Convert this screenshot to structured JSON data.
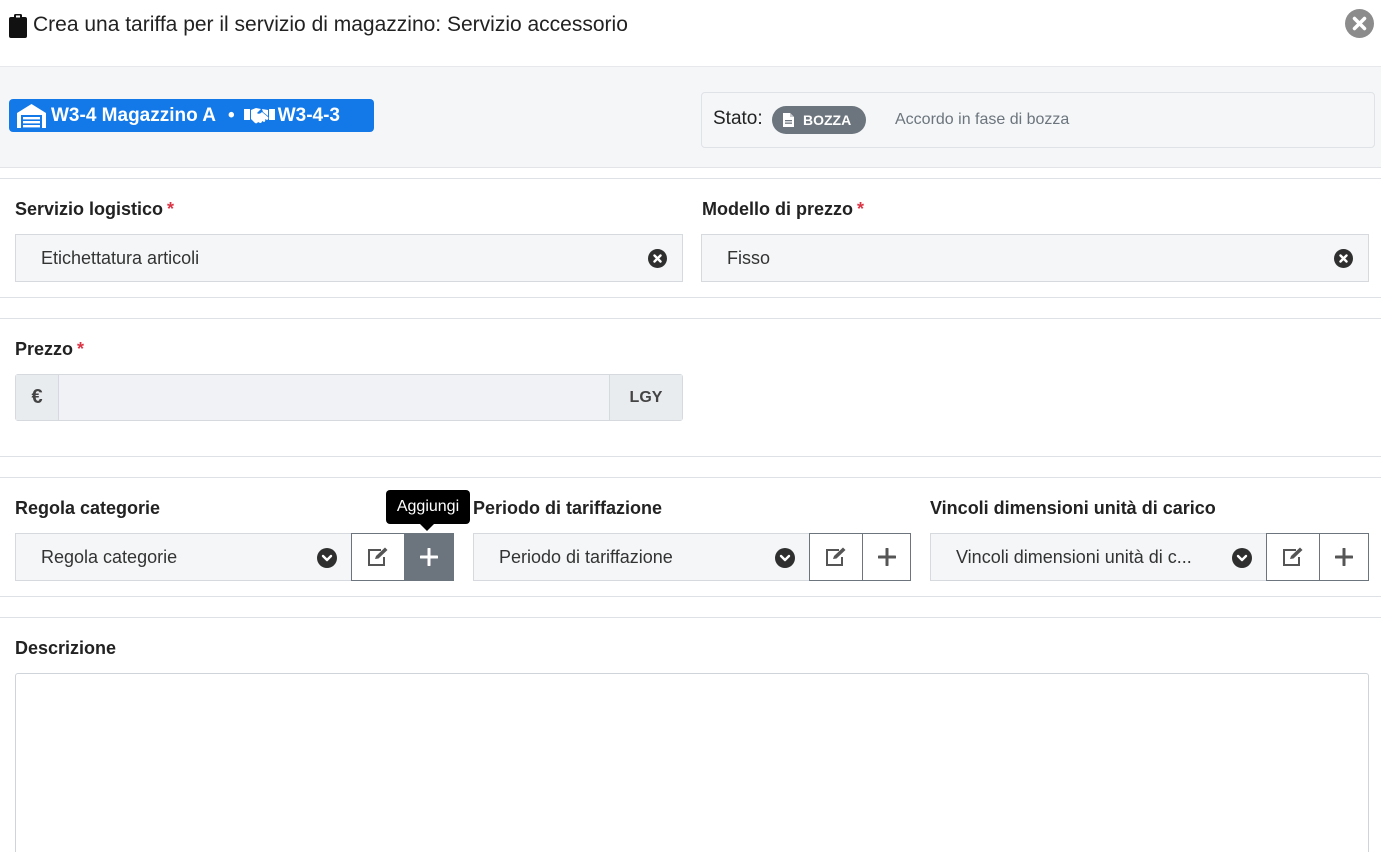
{
  "modal": {
    "title": "Crea una tariffa per il servizio di magazzino: Servizio accessorio",
    "title_icon": "clipboard-icon",
    "close_icon": "close-circle-icon"
  },
  "header_info": {
    "warehouse_label": "W3-4 Magazzino A",
    "separator": "•",
    "agreement_label": "W3-4-3",
    "warehouse_icon": "warehouse-icon",
    "agreement_icon": "handshake-icon",
    "badge_color": "#1379e8",
    "status": {
      "label": "Stato:",
      "badge": "BOZZA",
      "badge_icon": "file-icon",
      "badge_color": "#6c757d",
      "description": "Accordo in fase di bozza"
    }
  },
  "form": {
    "required_marker": "*",
    "servizio_logistico": {
      "label": "Servizio logistico",
      "value": "Etichettatura articoli"
    },
    "modello_prezzo": {
      "label": "Modello di prezzo",
      "value": "Fisso"
    },
    "prezzo": {
      "label": "Prezzo",
      "prefix": "€",
      "value": "",
      "suffix": "LGY"
    },
    "regola_categorie": {
      "label": "Regola categorie",
      "placeholder": "Regola categorie"
    },
    "periodo_tariffazione": {
      "label": "Periodo di tariffazione",
      "placeholder": "Periodo di tariffazione"
    },
    "vincoli": {
      "label": "Vincoli dimensioni unità di carico",
      "placeholder": "Vincoli dimensioni unità di c..."
    },
    "descrizione": {
      "label": "Descrizione",
      "value": ""
    }
  },
  "tooltip": {
    "text": "Aggiungi"
  },
  "colors": {
    "required": "#dc3545",
    "active_button": "#6c757d"
  }
}
